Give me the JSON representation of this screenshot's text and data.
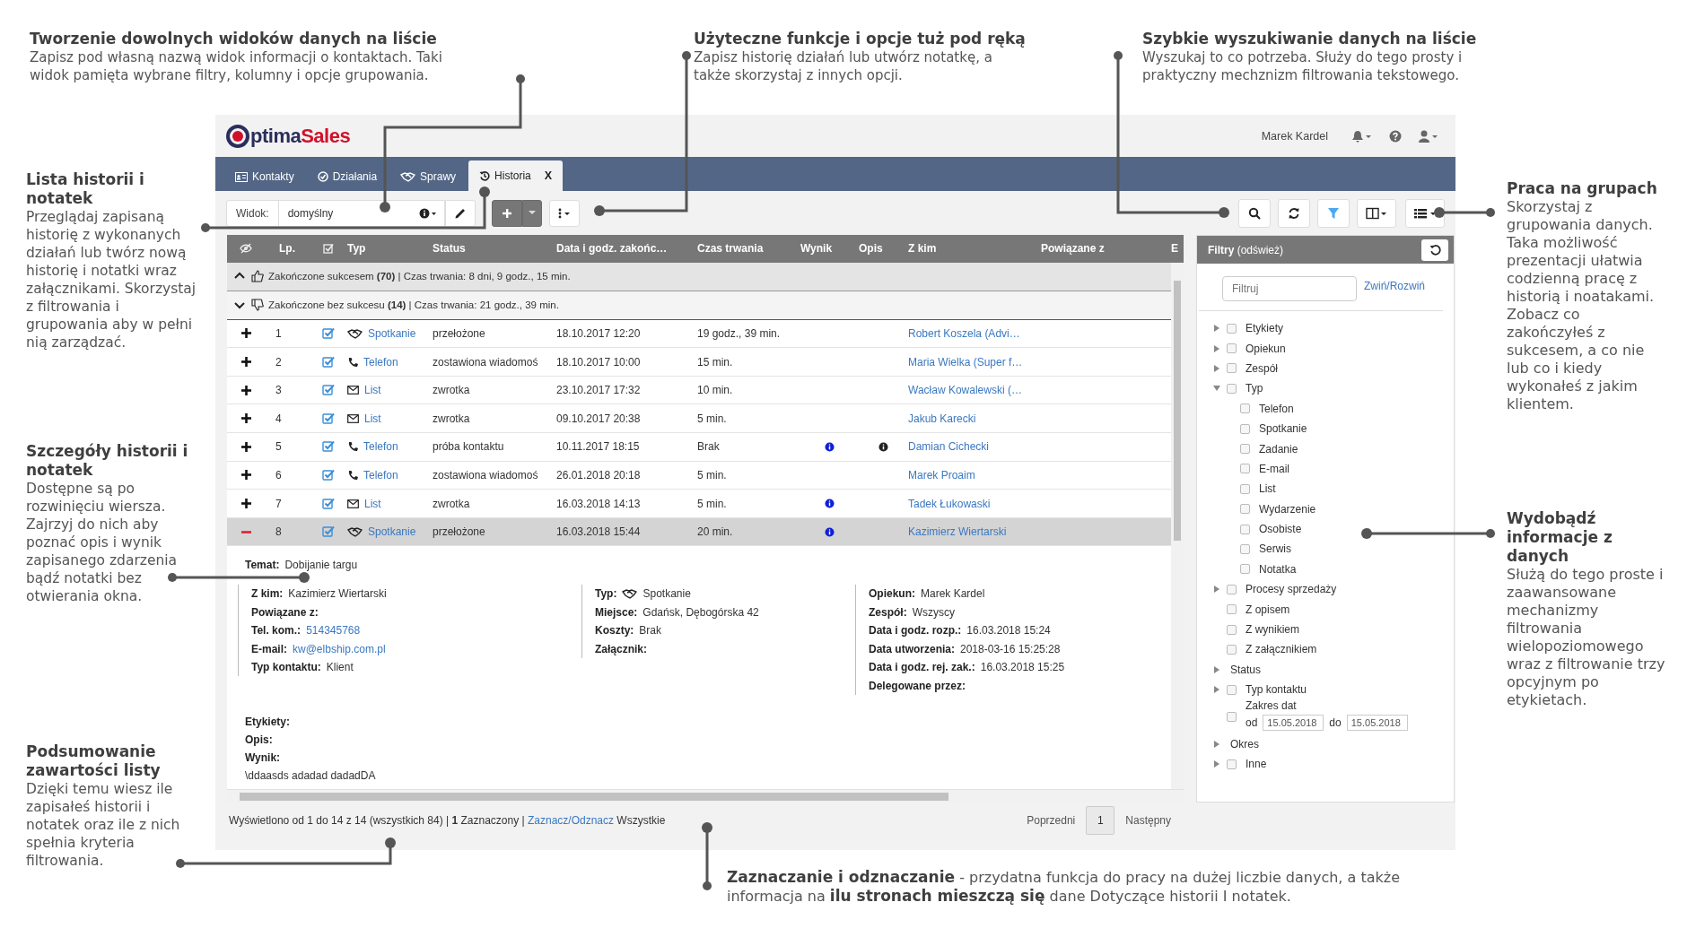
{
  "notes": {
    "top": [
      {
        "title": "Tworzenie dowolnych widoków danych na liście",
        "body": "Zapisz pod własną nazwą widok informacji o kontaktach. Taki widok pamięta wybrane filtry, kolumny i opcje grupowania."
      },
      {
        "title": "Użyteczne funkcje i opcje tuż pod ręką",
        "body": "Zapisz historię działań lub utwórz notatkę, a także skorzystaj z innych opcji."
      },
      {
        "title": "Szybkie wyszukiwanie danych na liście",
        "body": "Wyszukaj to co potrzeba. Służy do tego prosty i praktyczny mechznizm filtrowania tekstowego."
      }
    ],
    "left": [
      {
        "title": "Lista historii i notatek",
        "body": "Przeglądaj zapisaną historię z wykonanych działań lub twórz nową historię i notatki wraz załącznikami. Skorzystaj z filtrowania i grupowania aby w pełni nią zarządzać."
      },
      {
        "title": "Szczegóły historii i notatek",
        "body": "Dostępne są po rozwinięciu wiersza. Zajrzyj do nich aby poznać opis i wynik zapisanego zdarzenia bądź notatki bez otwierania okna."
      },
      {
        "title": "Podsumowanie zawartości listy",
        "body": "Dzięki temu wiesz ile zapisałeś historii i notatek oraz ile z nich spełnia kryteria filtrowania."
      }
    ],
    "right": [
      {
        "title": "Praca na grupach",
        "body": "Skorzystaj z grupowania danych. Taka możliwość prezentacji ułatwia codzienną pracę z historią i noatakami. Zobacz co zakończyłeś z sukcesem, a co nie lub co i kiedy wykonałeś z jakim klientem."
      },
      {
        "title": "Wydobądź informacje z danych",
        "body": "Służą do tego proste i zaawansowane mechanizmy filtrowania wielopoziomowego wraz z filtrowanie trzy opcyjnym po etykietach."
      }
    ],
    "bottom": "**Zaznaczanie i odznaczanie** - przydatna funkcja do pracy na dużej liczbie danych, a także informacja na **ilu stronach mieszczą się** dane Dotyczące historii I notatek."
  },
  "header": {
    "logo_first": "ptima",
    "logo_second": "Sales",
    "user": "Marek Kardel"
  },
  "tabs": [
    {
      "label": "Kontakty",
      "kind": "contacts",
      "selected": false
    },
    {
      "label": "Działania",
      "kind": "tasks",
      "selected": false
    },
    {
      "label": "Sprawy",
      "kind": "deals",
      "selected": false
    },
    {
      "label": "Historia",
      "kind": "history",
      "selected": true,
      "close": "X"
    }
  ],
  "toolbar": {
    "view_label": "Widok:",
    "view_value": "domyślny"
  },
  "table": {
    "columns": [
      {
        "kind": "eye"
      },
      {
        "kind": "text",
        "label": "Lp."
      },
      {
        "kind": "check"
      },
      {
        "kind": "text",
        "label": "Typ"
      },
      {
        "kind": "text",
        "label": "Status"
      },
      {
        "kind": "text",
        "label": "Data i godz. zakońc…"
      },
      {
        "kind": "text",
        "label": "Czas trwania"
      },
      {
        "kind": "text",
        "label": "Wynik"
      },
      {
        "kind": "text",
        "label": "Opis"
      },
      {
        "kind": "text",
        "label": "Z kim"
      },
      {
        "kind": "text",
        "label": "Powiązane z"
      },
      {
        "kind": "text",
        "label": "E"
      }
    ],
    "groups": [
      {
        "kind": "success",
        "expanded": false,
        "label": "Zakończone sukcesem **(70)** | Czas trwania: 8 dni, 9 godz., 15 min."
      },
      {
        "kind": "failure",
        "expanded": true,
        "label": "Zakończone bez sukcesu **(14)** | Czas trwania: 21 godz., 39 min."
      }
    ],
    "rows": [
      {
        "expanded": false,
        "number": "1",
        "checked": true,
        "kind": "meeting",
        "type": "Spotkanie",
        "status": "przełożone",
        "end": "18.10.2017 12:20",
        "duration": "19 godz., 39 min.",
        "result_info": false,
        "description_info": false,
        "contact": "Robert Koszela (Advi…"
      },
      {
        "expanded": false,
        "number": "2",
        "checked": true,
        "kind": "phone",
        "type": "Telefon",
        "status": "zostawiona wiadomoś",
        "end": "18.10.2017 10:00",
        "duration": "15 min.",
        "result_info": false,
        "description_info": false,
        "contact": "Maria Wielka (Super f…"
      },
      {
        "expanded": false,
        "number": "3",
        "checked": true,
        "kind": "letter",
        "type": "List",
        "status": "zwrotka",
        "end": "23.10.2017 17:32",
        "duration": "10 min.",
        "result_info": false,
        "description_info": false,
        "contact": "Wacław Kowalewski (…"
      },
      {
        "expanded": false,
        "number": "4",
        "checked": true,
        "kind": "letter",
        "type": "List",
        "status": "zwrotka",
        "end": "09.10.2017 20:38",
        "duration": "5 min.",
        "result_info": false,
        "description_info": false,
        "contact": "Jakub Karecki"
      },
      {
        "expanded": false,
        "number": "5",
        "checked": true,
        "kind": "phone",
        "type": "Telefon",
        "status": "próba kontaktu",
        "end": "10.11.2017 18:15",
        "duration": "Brak",
        "result_info": true,
        "description_info": true,
        "contact": "Damian Cichecki"
      },
      {
        "expanded": false,
        "number": "6",
        "checked": true,
        "kind": "phone",
        "type": "Telefon",
        "status": "zostawiona wiadomoś",
        "end": "26.01.2018 20:18",
        "duration": "5 min.",
        "result_info": false,
        "description_info": false,
        "contact": "Marek Proaim"
      },
      {
        "expanded": false,
        "number": "7",
        "checked": true,
        "kind": "letter",
        "type": "List",
        "status": "zwrotka",
        "end": "16.03.2018 14:13",
        "duration": "5 min.",
        "result_info": true,
        "description_info": false,
        "contact": "Tadek Łukowaski"
      },
      {
        "expanded": true,
        "number": "8",
        "checked": true,
        "kind": "meeting",
        "type": "Spotkanie",
        "status": "przełożone",
        "end": "16.03.2018 15:44",
        "duration": "20 min.",
        "result_info": true,
        "description_info": false,
        "contact": "Kazimierz Wiertarski"
      }
    ],
    "detail": {
      "subject_label": "Temat:",
      "subject": "Dobijanie targu",
      "columns": [
        [
          {
            "label": "Z kim:",
            "kind": "text",
            "value": "Kazimierz Wiertarski"
          },
          {
            "label": "Powiązane z:"
          },
          {
            "label": "Tel. kom.:",
            "kind": "link",
            "value": "514345768"
          },
          {
            "label": "E-mail:",
            "kind": "link",
            "value": "kw@elbship.com.pl"
          },
          {
            "label": "Typ kontaktu:",
            "kind": "text",
            "value": "Klient"
          }
        ],
        [
          {
            "label": "Typ:",
            "kind": "meeting",
            "value": "Spotkanie"
          },
          {
            "label": "Miejsce:",
            "kind": "text",
            "value": "Gdańsk, Dębogórska 42"
          },
          {
            "label": "Koszty:",
            "kind": "text",
            "value": "Brak"
          },
          {
            "label": "Załącznik:"
          }
        ],
        [
          {
            "label": "Opiekun:",
            "kind": "text",
            "value": "Marek Kardel"
          },
          {
            "label": "Zespół:",
            "kind": "text",
            "value": "Wszyscy"
          },
          {
            "label": "Data i godz. rozp.:",
            "kind": "text",
            "value": "16.03.2018 15:24"
          },
          {
            "label": "Data utworzenia:",
            "kind": "text",
            "value": "2018-03-16 15:25:28"
          },
          {
            "label": "Data i godz. rej. zak.:",
            "kind": "text",
            "value": "16.03.2018 15:25"
          },
          {
            "label": "Delegowane przez:"
          }
        ]
      ],
      "extra": [
        {
          "label": "Etykiety:"
        },
        {
          "label": "Opis:"
        },
        {
          "label": "Wynik:",
          "value": "\\ddaasds adadad dadadDA"
        }
      ]
    }
  },
  "footer": {
    "summary": "Wyświetlono od 1 do 14 z 14 (wszystkich 84) | **1** Zaznaczony |",
    "link": "Zaznacz/Odznacz",
    "after": "Wszystkie",
    "previous": "Poprzedni",
    "pages": [
      {
        "label": "1",
        "selected": true
      }
    ],
    "next": "Następny"
  },
  "filters": {
    "title": "**Filtry** (odśwież)",
    "placeholder": "Filtruj",
    "toggle": "Zwiń/Rozwiń",
    "items": [
      {
        "label": "Etykiety",
        "expanded": false,
        "checked": false
      },
      {
        "label": "Opiekun",
        "expanded": false,
        "checked": false
      },
      {
        "label": "Zespół",
        "expanded": false,
        "checked": false
      },
      {
        "label": "Typ",
        "expanded": true,
        "checked": false,
        "children": [
          {
            "label": "Telefon",
            "checked": false
          },
          {
            "label": "Spotkanie",
            "checked": false
          },
          {
            "label": "Zadanie",
            "checked": false
          },
          {
            "label": "E-mail",
            "checked": false
          },
          {
            "label": "List",
            "checked": false
          },
          {
            "label": "Wydarzenie",
            "checked": false
          },
          {
            "label": "Osobiste",
            "checked": false
          },
          {
            "label": "Serwis",
            "checked": false
          },
          {
            "label": "Notatka",
            "checked": false
          }
        ]
      },
      {
        "label": "Procesy sprzedaży",
        "expanded": false,
        "checked": false
      },
      {
        "label": "Z opisem",
        "checked": false
      },
      {
        "label": "Z wynikiem",
        "checked": false
      },
      {
        "label": "Z załącznikiem",
        "checked": false
      },
      {
        "label": "Status",
        "expanded": false
      },
      {
        "label": "Typ kontaktu",
        "expanded": false,
        "checked": false
      },
      {
        "label": "Zakres dat",
        "checked": false,
        "range": {
          "from_label": "od",
          "from": "15.05.2018",
          "to_label": "do",
          "to": "15.05.2018"
        }
      },
      {
        "label": "Okres",
        "expanded": false
      },
      {
        "label": "Inne",
        "expanded": false,
        "checked": false
      }
    ]
  }
}
